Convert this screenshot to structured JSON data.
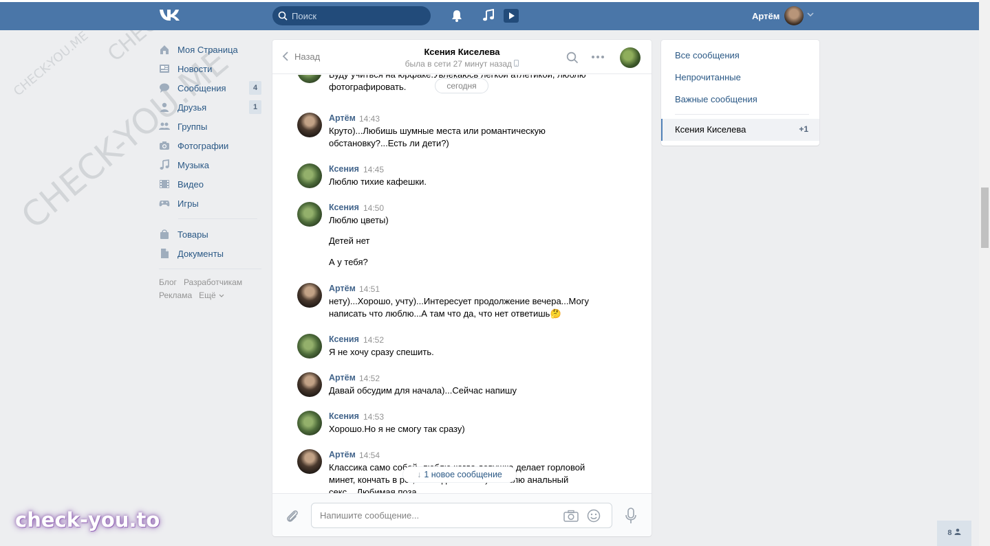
{
  "header": {
    "search_placeholder": "Поиск",
    "user_name": "Артём"
  },
  "sidebar": {
    "items": [
      {
        "label": "Моя Страница",
        "icon": "home-icon"
      },
      {
        "label": "Новости",
        "icon": "news-icon"
      },
      {
        "label": "Сообщения",
        "icon": "messages-icon",
        "badge": "4"
      },
      {
        "label": "Друзья",
        "icon": "friends-icon",
        "badge": "1"
      },
      {
        "label": "Группы",
        "icon": "groups-icon"
      },
      {
        "label": "Фотографии",
        "icon": "camera-icon"
      },
      {
        "label": "Музыка",
        "icon": "music-icon"
      },
      {
        "label": "Видео",
        "icon": "video-icon"
      },
      {
        "label": "Игры",
        "icon": "gamepad-icon"
      }
    ],
    "items2": [
      {
        "label": "Товары",
        "icon": "bag-icon"
      },
      {
        "label": "Документы",
        "icon": "document-icon"
      }
    ],
    "footer": [
      "Блог",
      "Разработчикам",
      "Реклама",
      "Ещё"
    ]
  },
  "chat": {
    "back_label": "Назад",
    "peer_name": "Ксения Киселева",
    "peer_status": "была в сети 27 минут назад",
    "day_divider": "сегодня",
    "first_text": "Буду учиться на юрфаке.Увлекаюсь легкой атлетикой, люблю фотографировать.",
    "messages": [
      {
        "author": "Артём",
        "time": "14:43",
        "text": "Круто)...Любишь шумные места или романтическую обстановку?...Есть ли дети?)"
      },
      {
        "author": "Ксения",
        "time": "14:45",
        "text": "Люблю тихие кафешки."
      },
      {
        "author": "Ксения",
        "time": "14:50",
        "text": "Люблю цветы)",
        "extra": [
          "Детей нет",
          "А у тебя?"
        ]
      },
      {
        "author": "Артём",
        "time": "14:51",
        "text": "нету)...Хорошо, учту)...Интересует продолжение вечера...Могу написать что люблю...А там что да, что нет ответишь🤔"
      },
      {
        "author": "Ксения",
        "time": "14:52",
        "text": "Я не хочу сразу спешить."
      },
      {
        "author": "Артём",
        "time": "14:52",
        "text": "Давай обсудим для начала)...Сейчас напишу"
      },
      {
        "author": "Ксения",
        "time": "14:53",
        "text": "Хорошо.Но я не смогу так сразу)"
      },
      {
        "author": "Артём",
        "time": "14:54",
        "text": "Классика само собой, люблю когда девушка делает горловой минет, кончать в рот, но когда глотает)...Люблю анальный секс....Любимая поза"
      }
    ],
    "new_message_label": "1 новое сообщение",
    "compose_placeholder": "Напишите сообщение..."
  },
  "right_menu": {
    "items": [
      "Все сообщения",
      "Непрочитанные",
      "Важные сообщения"
    ],
    "active": {
      "name": "Ксения Киселева",
      "count": "+1"
    }
  },
  "online_count": "8",
  "watermark": {
    "brand": "check-you.to",
    "diagonal": [
      "CHECK-YOU.ME",
      "CHECK-YOU.ME",
      "CHECK-YOU.ME"
    ]
  },
  "colors": {
    "header": "#4a76a8",
    "link": "#2a5885",
    "author": "#42648b"
  }
}
